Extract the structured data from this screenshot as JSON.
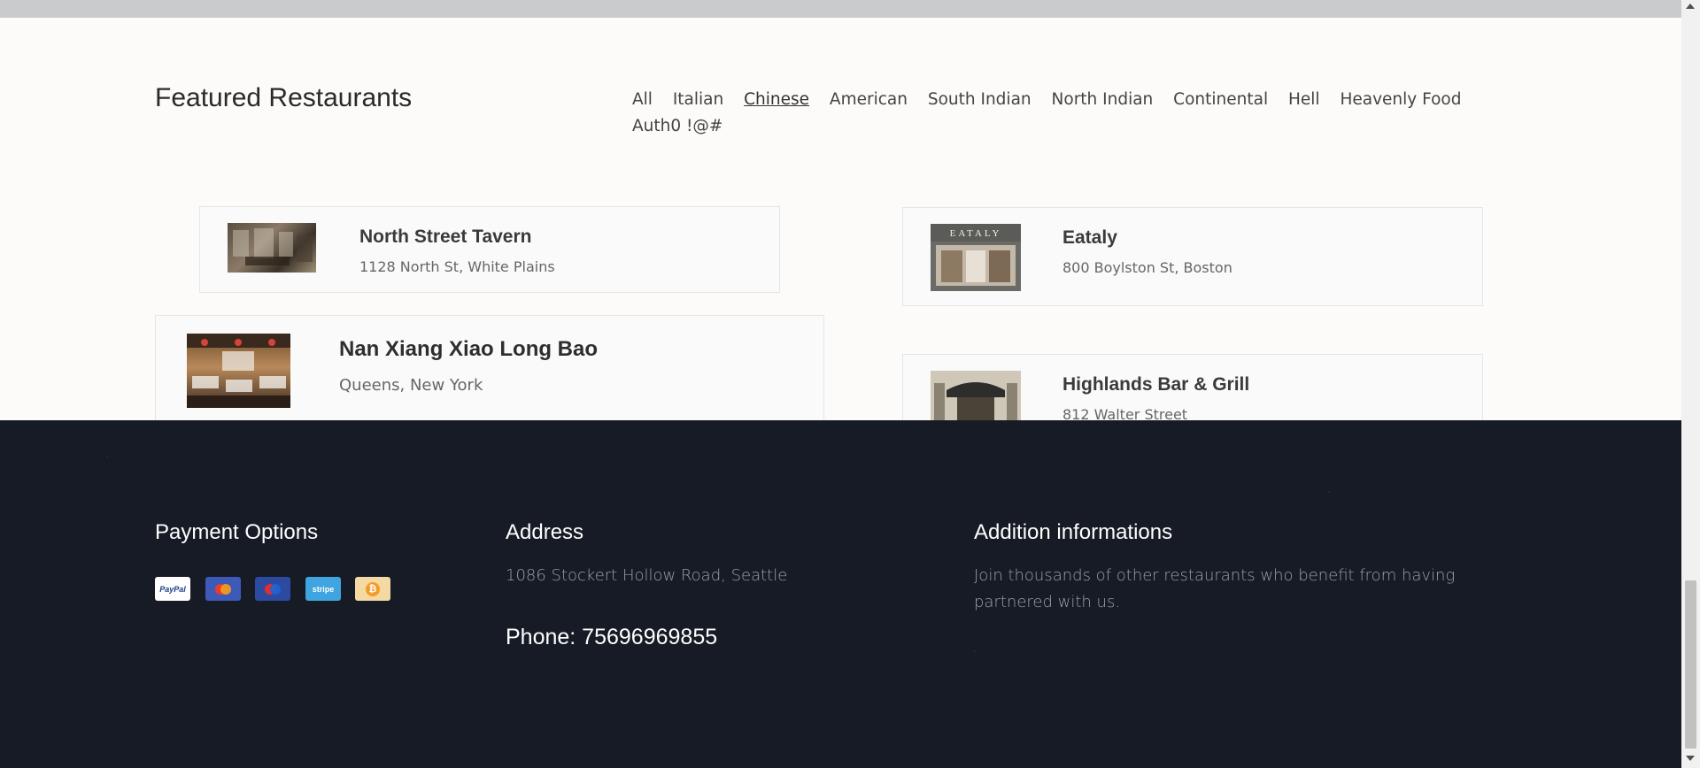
{
  "featured": {
    "title": "Featured Restaurants",
    "filters": [
      {
        "label": "All",
        "active": false
      },
      {
        "label": "Italian",
        "active": false
      },
      {
        "label": "Chinese",
        "active": true
      },
      {
        "label": "American",
        "active": false
      },
      {
        "label": "South Indian",
        "active": false
      },
      {
        "label": "North Indian",
        "active": false
      },
      {
        "label": "Continental",
        "active": false
      },
      {
        "label": "Hell",
        "active": false
      },
      {
        "label": "Heavenly Food",
        "active": false
      },
      {
        "label": "Auth0 !@#",
        "active": false
      }
    ]
  },
  "restaurants": [
    {
      "name": "North Street Tavern",
      "address": "1128 North St, White Plains"
    },
    {
      "name": "Nan Xiang Xiao Long Bao",
      "address": "Queens, New York"
    },
    {
      "name": "Eataly",
      "address": "800 Boylston St, Boston",
      "logo_text": "EATALY"
    },
    {
      "name": "Highlands Bar & Grill",
      "address": "812 Walter Street"
    }
  ],
  "footer": {
    "payment_title": "Payment Options",
    "payment_methods": [
      {
        "label": "PayPal",
        "icon": "paypal-icon",
        "bg": "#ffffff",
        "fg": "#1b3f8c"
      },
      {
        "label": "",
        "icon": "mastercard-icon",
        "bg": "#3e5ab8",
        "fg": "#ffffff"
      },
      {
        "label": "",
        "icon": "maestro-icon",
        "bg": "#2c4aa0",
        "fg": "#ffffff"
      },
      {
        "label": "stripe",
        "icon": "stripe-icon",
        "bg": "#3fa5e0",
        "fg": "#ffffff"
      },
      {
        "label": "₿",
        "icon": "bitcoin-icon",
        "bg": "#f4d9a3",
        "fg": "#f49b25"
      }
    ],
    "address_title": "Address",
    "address": "1086 Stockert Hollow Road, Seattle",
    "phone": "Phone: 75696969855",
    "info_title": "Addition informations",
    "info_text": "Join thousands of other restaurants who benefit from having partnered with us."
  }
}
